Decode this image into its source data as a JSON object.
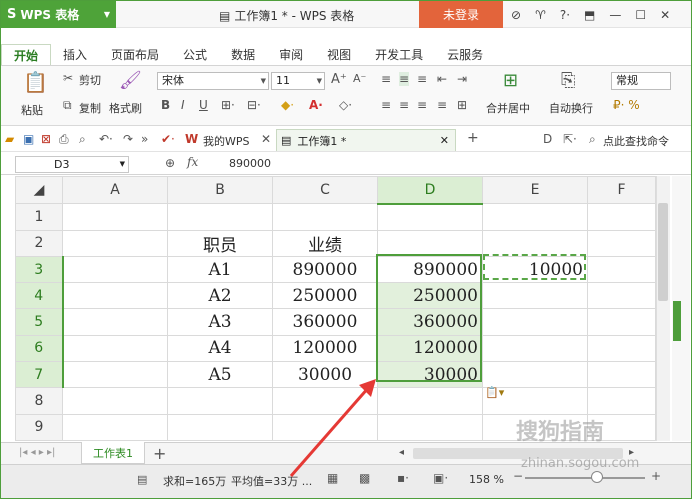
{
  "app": {
    "name": "WPS 表格",
    "window_title": "工作簿1 * - WPS 表格",
    "login_label": "未登录"
  },
  "tabs": [
    "开始",
    "插入",
    "页面布局",
    "公式",
    "数据",
    "审阅",
    "视图",
    "开发工具",
    "云服务"
  ],
  "ribbon": {
    "paste": "粘贴",
    "cut": "剪切",
    "copy": "复制",
    "format_painter": "格式刷",
    "font_name": "宋体",
    "font_size": "11",
    "merge_center": "合并居中",
    "wrap_text": "自动换行",
    "number_format": "常规"
  },
  "quickbar": {
    "my_wps": "我的WPS",
    "doc_tab": "工作簿1 *",
    "find_command": "点此查找命令"
  },
  "formula_bar": {
    "name_box": "D3",
    "fx": "fx",
    "value": "890000"
  },
  "grid": {
    "columns": [
      "A",
      "B",
      "C",
      "D",
      "E",
      "F"
    ],
    "rows": [
      {
        "n": "1",
        "a": "",
        "b": "",
        "c": "",
        "d": "",
        "e": ""
      },
      {
        "n": "2",
        "a": "",
        "b": "职员",
        "c": "业绩",
        "d": "",
        "e": ""
      },
      {
        "n": "3",
        "a": "",
        "b": "A1",
        "c": "890000",
        "d": "890000",
        "e": "10000"
      },
      {
        "n": "4",
        "a": "",
        "b": "A2",
        "c": "250000",
        "d": "250000",
        "e": ""
      },
      {
        "n": "5",
        "a": "",
        "b": "A3",
        "c": "360000",
        "d": "360000",
        "e": ""
      },
      {
        "n": "6",
        "a": "",
        "b": "A4",
        "c": "120000",
        "d": "120000",
        "e": ""
      },
      {
        "n": "7",
        "a": "",
        "b": "A5",
        "c": "30000",
        "d": "30000",
        "e": ""
      },
      {
        "n": "8",
        "a": "",
        "b": "",
        "c": "",
        "d": "",
        "e": ""
      },
      {
        "n": "9",
        "a": "",
        "b": "",
        "c": "",
        "d": "",
        "e": ""
      }
    ]
  },
  "sheet": {
    "tab": "工作表1",
    "add": "+"
  },
  "status": {
    "sum": "求和=165万",
    "avg": "平均值=33万 ...",
    "zoom": "158 %"
  },
  "watermark": {
    "text": "搜狗指南",
    "url": "zhinan.sogou.com"
  },
  "colors": {
    "accent": "#4e9e3b",
    "login": "#e3643b",
    "selection": "#e2f0dc",
    "arrow": "#e53935"
  }
}
